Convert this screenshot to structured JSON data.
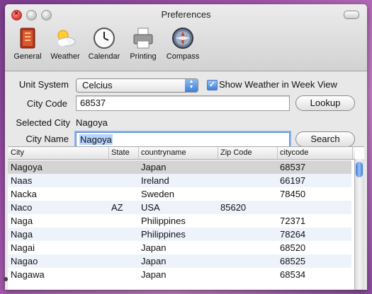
{
  "window": {
    "title": "Preferences"
  },
  "toolbar": {
    "items": [
      {
        "label": "General",
        "icon": "general-book-icon"
      },
      {
        "label": "Weather",
        "icon": "weather-sun-cloud-icon"
      },
      {
        "label": "Calendar",
        "icon": "clock-icon"
      },
      {
        "label": "Printing",
        "icon": "printer-icon"
      },
      {
        "label": "Compass",
        "icon": "compass-icon"
      }
    ]
  },
  "form": {
    "unit_system_label": "Unit System",
    "unit_system_value": "Celcius",
    "show_weather_label": "Show Weather in Week View",
    "show_weather_checked": true,
    "city_code_label": "City Code",
    "city_code_value": "68537",
    "lookup_button": "Lookup",
    "selected_city_label": "Selected City",
    "selected_city_value": "Nagoya",
    "city_name_label": "City Name",
    "city_name_value": "Nagoya",
    "search_button": "Search"
  },
  "table": {
    "columns": [
      "City",
      "State",
      "countryname",
      "Zip Code",
      "citycode"
    ],
    "rows": [
      {
        "city": "Nagoya",
        "state": "",
        "country": "Japan",
        "zip": "",
        "code": "68537",
        "selected": true
      },
      {
        "city": "Naas",
        "state": "",
        "country": "Ireland",
        "zip": "",
        "code": "66197"
      },
      {
        "city": "Nacka",
        "state": "",
        "country": "Sweden",
        "zip": "",
        "code": "78450"
      },
      {
        "city": "Naco",
        "state": "AZ",
        "country": "USA",
        "zip": "85620",
        "code": ""
      },
      {
        "city": "Naga",
        "state": "",
        "country": "Philippines",
        "zip": "",
        "code": "72371"
      },
      {
        "city": "Naga",
        "state": "",
        "country": "Philippines",
        "zip": "",
        "code": "78264"
      },
      {
        "city": "Nagai",
        "state": "",
        "country": "Japan",
        "zip": "",
        "code": "68520"
      },
      {
        "city": "Nagao",
        "state": "",
        "country": "Japan",
        "zip": "",
        "code": "68525"
      },
      {
        "city": "Nagawa",
        "state": "",
        "country": "Japan",
        "zip": "",
        "code": "68534"
      }
    ]
  },
  "colors": {
    "accent": "#3f7fd8",
    "desktop": "#a054a8",
    "selection": "#d4d4d4"
  }
}
